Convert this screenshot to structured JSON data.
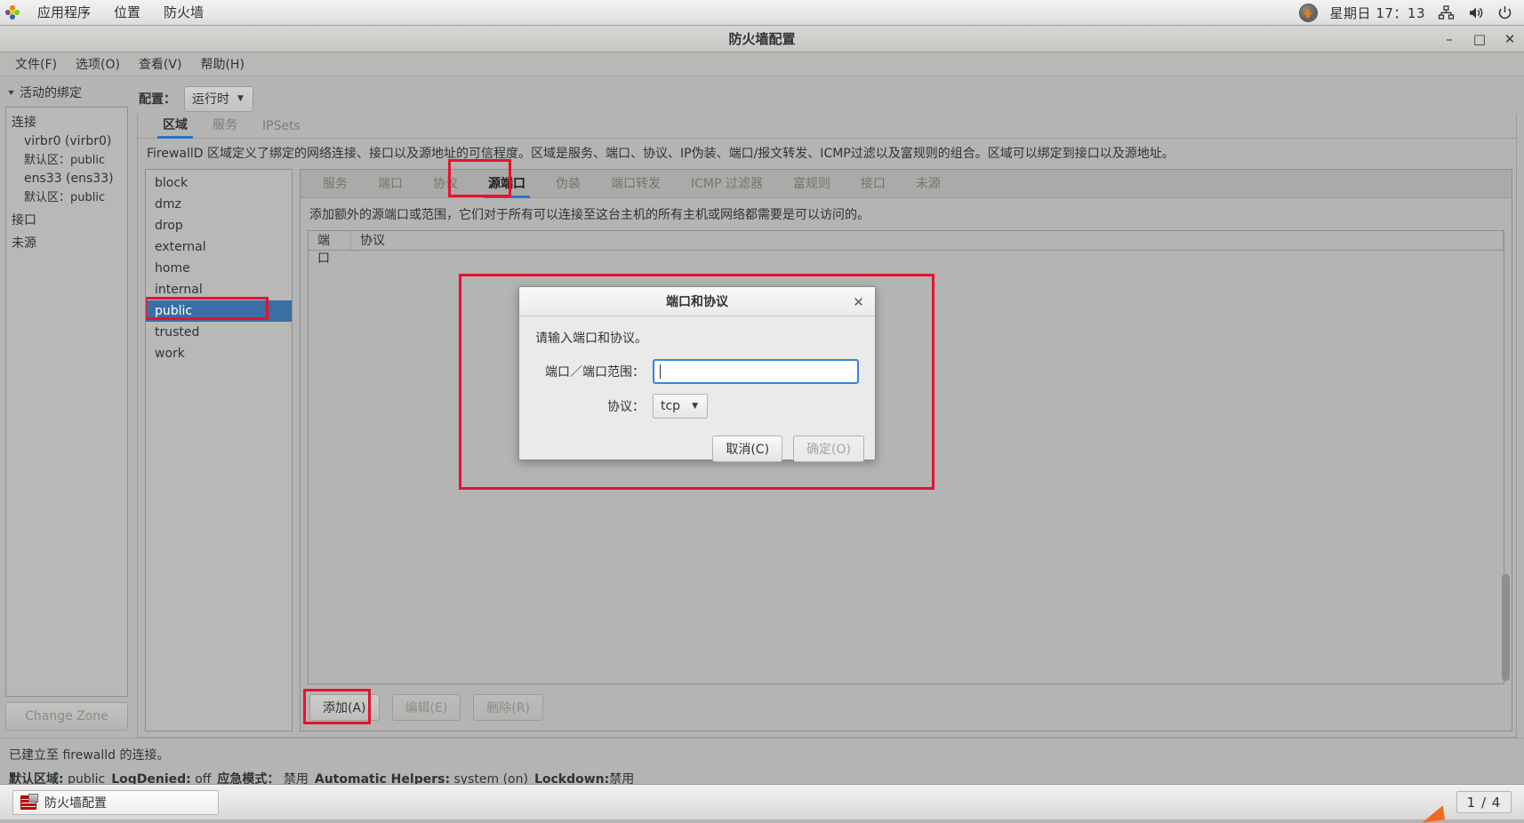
{
  "desktop": {
    "panel": {
      "apps_label": "应用程序",
      "places_label": "位置",
      "app_menu_label": "防火墙",
      "tray_app_glyph": "⚡",
      "clock": "星期日 17：13",
      "icons": [
        "network-icon",
        "volume-icon",
        "power-icon"
      ]
    },
    "taskbar": {
      "window_button": "防火墙配置",
      "workspace": "1 / 4"
    }
  },
  "window": {
    "title": "防火墙配置",
    "buttons": {
      "minimize": "–",
      "maximize": "□",
      "close": "✕"
    },
    "menu": [
      "文件(F)",
      "选项(O)",
      "查看(V)",
      "帮助(H)"
    ]
  },
  "sidebar": {
    "expander_label": "活动的绑定",
    "groups": [
      {
        "label": "连接",
        "items": [
          {
            "name": "virbr0 (virbr0)",
            "zone_label": "默认区",
            "zone_value": "public"
          },
          {
            "name": "ens33 (ens33)",
            "zone_label": "默认区",
            "zone_value": "public"
          }
        ]
      },
      {
        "label": "接口",
        "items": []
      },
      {
        "label": "未源",
        "items": []
      }
    ],
    "change_zone_button": "Change Zone"
  },
  "toolbar": {
    "config_label": "配置：",
    "config_value": "运行时"
  },
  "main_tabs": [
    {
      "label": "区域",
      "active": true
    },
    {
      "label": "服务",
      "active": false
    },
    {
      "label": "IPSets",
      "active": false
    }
  ],
  "zone_description": "FirewallD 区域定义了绑定的网络连接、接口以及源地址的可信程度。区域是服务、端口、协议、IP伪装、端口/报文转发、ICMP过滤以及富规则的组合。区域可以绑定到接口以及源地址。",
  "zones": [
    {
      "name": "block",
      "selected": false
    },
    {
      "name": "dmz",
      "selected": false
    },
    {
      "name": "drop",
      "selected": false
    },
    {
      "name": "external",
      "selected": false
    },
    {
      "name": "home",
      "selected": false
    },
    {
      "name": "internal",
      "selected": false
    },
    {
      "name": "public",
      "selected": true
    },
    {
      "name": "trusted",
      "selected": false
    },
    {
      "name": "work",
      "selected": false
    }
  ],
  "zone_tabs": [
    {
      "label": "服务",
      "active": false
    },
    {
      "label": "端口",
      "active": false
    },
    {
      "label": "协议",
      "active": false
    },
    {
      "label": "源端口",
      "active": true
    },
    {
      "label": "伪装",
      "active": false
    },
    {
      "label": "端口转发",
      "active": false
    },
    {
      "label": "ICMP 过滤器",
      "active": false
    },
    {
      "label": "富规则",
      "active": false
    },
    {
      "label": "接口",
      "active": false
    },
    {
      "label": "未源",
      "active": false
    }
  ],
  "source_ports": {
    "description": "添加额外的源端口或范围，它们对于所有可以连接至这台主机的所有主机或网络都需要是可以访问的。",
    "columns": [
      "端口",
      "协议"
    ],
    "rows": [],
    "actions": [
      {
        "label": "添加(A)",
        "enabled": true
      },
      {
        "label": "编辑(E)",
        "enabled": false
      },
      {
        "label": "删除(R)",
        "enabled": false
      }
    ]
  },
  "dialog": {
    "title": "端口和协议",
    "close_glyph": "✕",
    "prompt": "请输入端口和协议。",
    "port_label": "端口／端口范围：",
    "port_value": "",
    "protocol_label": "协议：",
    "protocol_value": "tcp",
    "cancel_label": "取消(C)",
    "ok_label": "确定(O)"
  },
  "status_bar": {
    "connection": "已建立至 firewalld 的连接。",
    "default_zone_label": "默认区域:",
    "default_zone_value": "public",
    "logdenied_label": "LogDenied:",
    "logdenied_value": "off",
    "panic_label": "应急模式：",
    "panic_value": "禁用",
    "helpers_label": "Automatic Helpers:",
    "helpers_value": "system (on)",
    "lockdown_label": "Lockdown:",
    "lockdown_value": "禁用"
  },
  "colors": {
    "annotation_red": "#e8112d",
    "selection_blue": "#3a6ea5",
    "tab_underline": "#2a74c4",
    "focus_blue": "#3584e4"
  }
}
